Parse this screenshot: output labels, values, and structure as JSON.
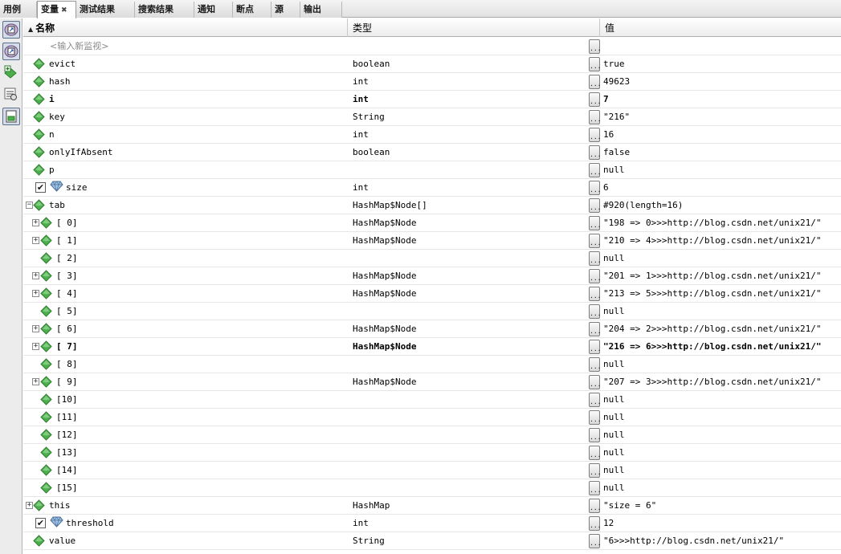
{
  "tabs": [
    {
      "label": "用例"
    },
    {
      "label": "变量",
      "close": "✖"
    },
    {
      "label": "测试结果"
    },
    {
      "label": "搜索结果"
    },
    {
      "label": "通知"
    },
    {
      "label": "断点"
    },
    {
      "label": "源"
    },
    {
      "label": "输出"
    }
  ],
  "toolbar": {
    "icons": [
      "watch-filter-icon",
      "watch-filter-alt-icon",
      "new-watch-icon",
      "view-settings-icon",
      "show-panel-icon"
    ]
  },
  "columns": {
    "name": "名称",
    "type": "类型",
    "value": "值"
  },
  "new_watch_placeholder": "<输入新监视>",
  "ellipsis": "...",
  "rows": [
    {
      "name": "evict",
      "type": "boolean",
      "value": "true"
    },
    {
      "name": "hash",
      "type": "int",
      "value": "49623"
    },
    {
      "name": "i",
      "type": "int",
      "value": "7"
    },
    {
      "name": "key",
      "type": "String",
      "value": "\"216\""
    },
    {
      "name": "n",
      "type": "int",
      "value": "16"
    },
    {
      "name": "onlyIfAbsent",
      "type": "boolean",
      "value": "false"
    },
    {
      "name": "p",
      "type": "",
      "value": "null"
    },
    {
      "name": "size",
      "type": "int",
      "value": "6"
    },
    {
      "name": "tab",
      "type": "HashMap$Node[]",
      "value": "#920(length=16)"
    },
    {
      "name": "[ 0]",
      "type": "HashMap$Node",
      "value": "\"198 => 0>>>http://blog.csdn.net/unix21/\""
    },
    {
      "name": "[ 1]",
      "type": "HashMap$Node",
      "value": "\"210 => 4>>>http://blog.csdn.net/unix21/\""
    },
    {
      "name": "[ 2]",
      "type": "",
      "value": "null"
    },
    {
      "name": "[ 3]",
      "type": "HashMap$Node",
      "value": "\"201 => 1>>>http://blog.csdn.net/unix21/\""
    },
    {
      "name": "[ 4]",
      "type": "HashMap$Node",
      "value": "\"213 => 5>>>http://blog.csdn.net/unix21/\""
    },
    {
      "name": "[ 5]",
      "type": "",
      "value": "null"
    },
    {
      "name": "[ 6]",
      "type": "HashMap$Node",
      "value": "\"204 => 2>>>http://blog.csdn.net/unix21/\""
    },
    {
      "name": "[ 7]",
      "type": "HashMap$Node",
      "value": "\"216 => 6>>>http://blog.csdn.net/unix21/\""
    },
    {
      "name": "[ 8]",
      "type": "",
      "value": "null"
    },
    {
      "name": "[ 9]",
      "type": "HashMap$Node",
      "value": "\"207 => 3>>>http://blog.csdn.net/unix21/\""
    },
    {
      "name": "[10]",
      "type": "",
      "value": "null"
    },
    {
      "name": "[11]",
      "type": "",
      "value": "null"
    },
    {
      "name": "[12]",
      "type": "",
      "value": "null"
    },
    {
      "name": "[13]",
      "type": "",
      "value": "null"
    },
    {
      "name": "[14]",
      "type": "",
      "value": "null"
    },
    {
      "name": "[15]",
      "type": "",
      "value": "null"
    },
    {
      "name": "this",
      "type": "HashMap",
      "value": "\"size = 6\""
    },
    {
      "name": "threshold",
      "type": "int",
      "value": "12"
    },
    {
      "name": "value",
      "type": "String",
      "value": "\"6>>>http://blog.csdn.net/unix21/\""
    }
  ],
  "colors": {
    "diamond": "#4bb04b",
    "diamond_dark": "#2f7d2f",
    "gem": "#9fc3e8"
  }
}
